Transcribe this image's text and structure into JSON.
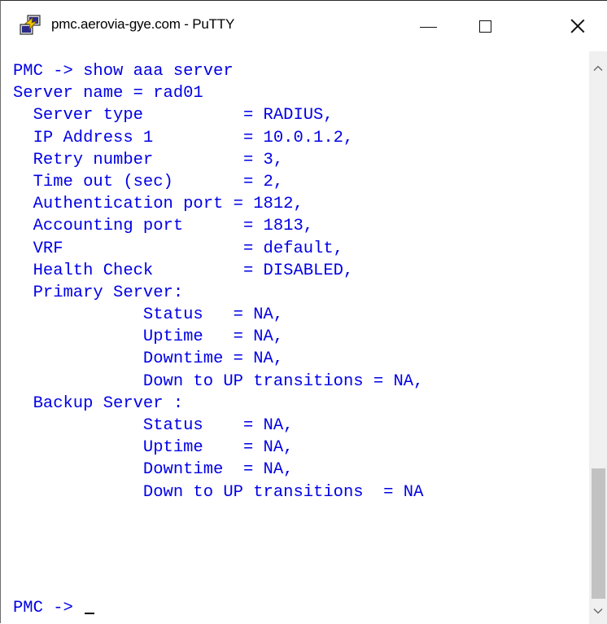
{
  "window": {
    "title": "pmc.aerovia-gye.com - PuTTY",
    "app_icon": "putty-icon",
    "controls": {
      "minimize": "minimize-icon",
      "maximize": "maximize-icon",
      "close": "close-icon"
    }
  },
  "terminal": {
    "text_color": "#0000e6",
    "background": "#ffffff",
    "lines": [
      "PMC -> show aaa server",
      "Server name = rad01",
      "  Server type          = RADIUS,",
      "  IP Address 1         = 10.0.1.2,",
      "  Retry number         = 3,",
      "  Time out (sec)       = 2,",
      "  Authentication port = 1812,",
      "  Accounting port      = 1813,",
      "  VRF                  = default,",
      "  Health Check         = DISABLED,",
      "  Primary Server:",
      "             Status   = NA,",
      "             Uptime   = NA,",
      "             Downtime = NA,",
      "             Down to UP transitions = NA,",
      "  Backup Server :",
      "             Status    = NA,",
      "             Uptime    = NA,",
      "             Downtime  = NA,",
      "             Down to UP transitions  = NA"
    ],
    "prompt": "PMC -> "
  },
  "scrollbar": {
    "up_icon": "chevron-up-icon",
    "down_icon": "chevron-down-icon"
  }
}
